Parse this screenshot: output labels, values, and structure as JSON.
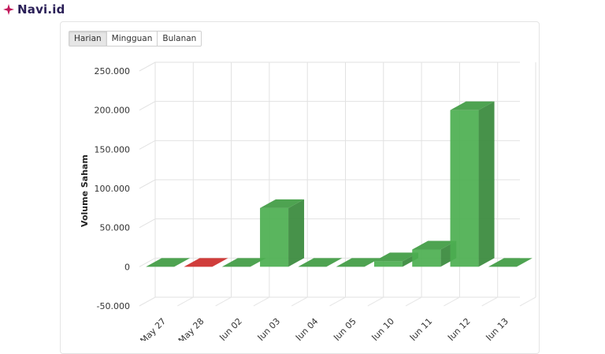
{
  "brand": {
    "name": "Navi.id",
    "logo_icon": "sparkle-icon",
    "color": "#c2185b"
  },
  "tabs": [
    {
      "label": "Harian",
      "active": true
    },
    {
      "label": "Mingguan",
      "active": false
    },
    {
      "label": "Bulanan",
      "active": false
    }
  ],
  "chart_data": {
    "type": "bar",
    "style": "3d",
    "ylabel": "Volume Saham",
    "xlabel": "",
    "ylim": [
      -50000,
      250000
    ],
    "yticks": [
      250000,
      200000,
      150000,
      100000,
      50000,
      0,
      -50000
    ],
    "ytick_labels": [
      "250.000",
      "200.000",
      "150.000",
      "100.000",
      "50.000",
      "0",
      "-50.000"
    ],
    "categories": [
      "May 27",
      "May 28",
      "Jun 02",
      "Jun 03",
      "Jun 04",
      "Jun 05",
      "Jun 10",
      "Jun 11",
      "Jun 12",
      "Jun 13"
    ],
    "values": [
      0,
      0,
      0,
      75000,
      0,
      0,
      7000,
      22000,
      200000,
      0
    ],
    "colors": [
      "#4caf50",
      "#e53935",
      "#4caf50",
      "#4caf50",
      "#4caf50",
      "#4caf50",
      "#4caf50",
      "#4caf50",
      "#4caf50",
      "#4caf50"
    ],
    "grid": true
  }
}
